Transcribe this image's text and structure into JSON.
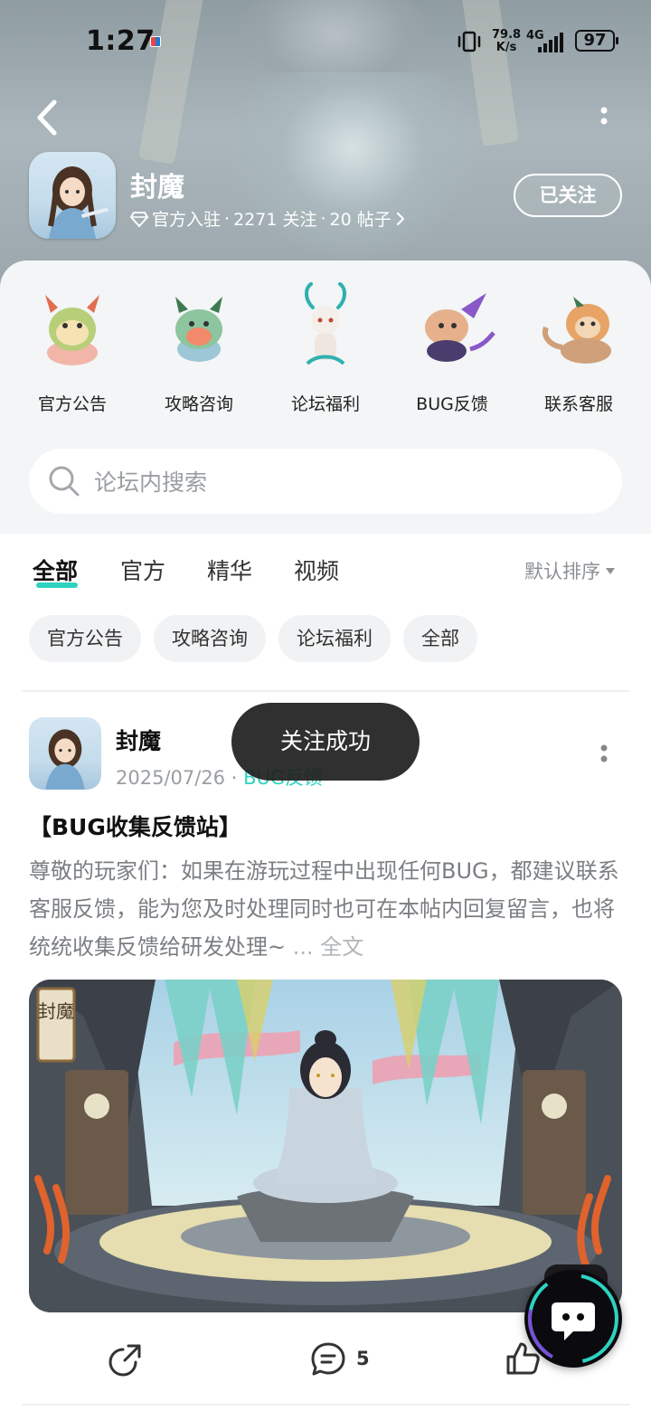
{
  "status_bar": {
    "time": "1:27",
    "net_speed_value": "79.8",
    "net_speed_unit": "K/s",
    "network_type": "4G",
    "battery": "97"
  },
  "header": {
    "forum_name": "封魔",
    "badge_label": "官方入驻",
    "followers": "2271 关注",
    "posts": "20 帖子",
    "separator": "·",
    "follow_button": "已关注",
    "icons": [
      "back-arrow-icon",
      "more-vertical-icon",
      "diamond-badge-icon",
      "chevron-right-icon"
    ]
  },
  "categories": [
    {
      "label": "官方公告",
      "icon": "mascot-dragon-green"
    },
    {
      "label": "攻略咨询",
      "icon": "mascot-dragon-teal"
    },
    {
      "label": "论坛福利",
      "icon": "mascot-deer-white"
    },
    {
      "label": "BUG反馈",
      "icon": "mascot-beast-purple"
    },
    {
      "label": "联系客服",
      "icon": "mascot-lion-orange"
    }
  ],
  "search": {
    "placeholder": "论坛内搜索"
  },
  "tabs": [
    {
      "label": "全部",
      "active": true
    },
    {
      "label": "官方",
      "active": false
    },
    {
      "label": "精华",
      "active": false
    },
    {
      "label": "视频",
      "active": false
    }
  ],
  "sort": {
    "label": "默认排序"
  },
  "chips": [
    "官方公告",
    "攻略咨询",
    "论坛福利",
    "全部"
  ],
  "post": {
    "author": "封魔",
    "date": "2025/07/26",
    "separator": "·",
    "tag": "BUG反馈",
    "title": "【BUG收集反馈站】",
    "body": "尊敬的玩家们：如果在游玩过程中出现任何BUG，都建议联系客服反馈，能为您及时处理同时也可在本帖内回复留言，也将统统收集反馈给研发处理~",
    "more": "... 全文",
    "image_caption": "封魔",
    "comments": "5"
  },
  "toast": {
    "text": "关注成功"
  },
  "colors": {
    "accent": "#2ed2c0",
    "panel_bg": "#f3f5f6",
    "chip_bg": "#f1f2f4",
    "toast_bg": "#1e1e1e"
  }
}
